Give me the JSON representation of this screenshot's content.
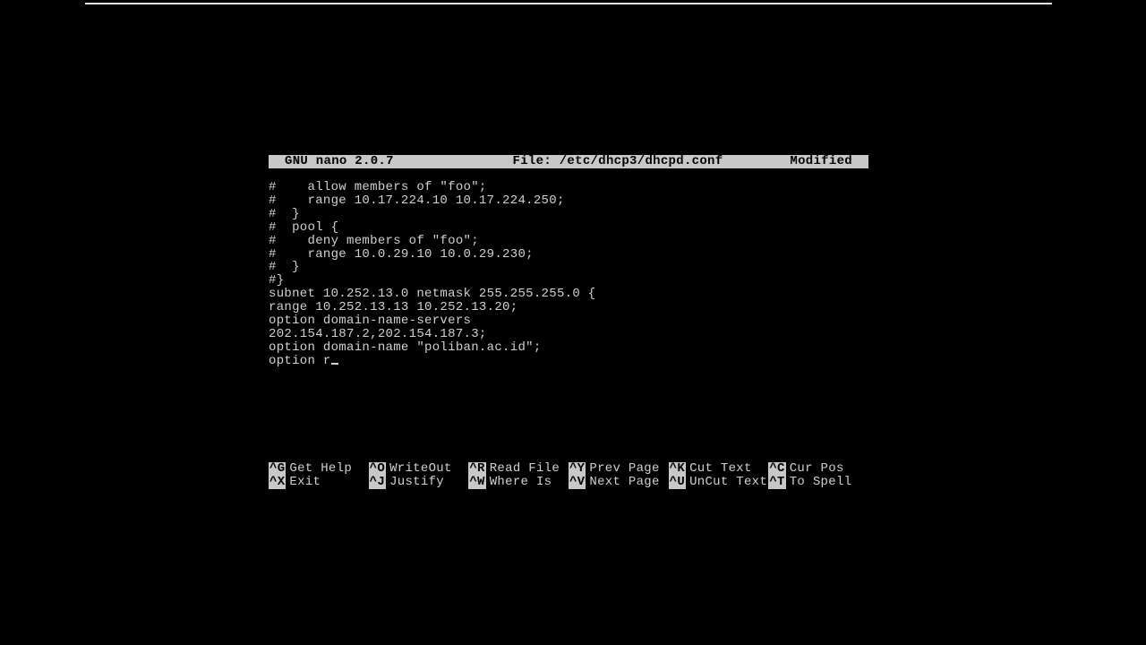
{
  "titlebar": {
    "app": "GNU nano 2.0.7",
    "file_prefix": "File: ",
    "file_path": "/etc/dhcp3/dhcpd.conf",
    "state": "Modified"
  },
  "buffer_lines": [
    "#    allow members of \"foo\";",
    "#    range 10.17.224.10 10.17.224.250;",
    "#  }",
    "#  pool {",
    "#    deny members of \"foo\";",
    "#    range 10.0.29.10 10.0.29.230;",
    "#  }",
    "#}",
    "subnet 10.252.13.0 netmask 255.255.255.0 {",
    "range 10.252.13.13 10.252.13.20;",
    "option domain-name-servers",
    "202.154.187.2,202.154.187.3;",
    "option domain-name \"poliban.ac.id\";",
    "option r"
  ],
  "cursor_line": 13,
  "shortcuts_row1": [
    {
      "key": "^G",
      "label": "Get Help"
    },
    {
      "key": "^O",
      "label": "WriteOut"
    },
    {
      "key": "^R",
      "label": "Read File"
    },
    {
      "key": "^Y",
      "label": "Prev Page"
    },
    {
      "key": "^K",
      "label": "Cut Text"
    },
    {
      "key": "^C",
      "label": "Cur Pos"
    }
  ],
  "shortcuts_row2": [
    {
      "key": "^X",
      "label": "Exit"
    },
    {
      "key": "^J",
      "label": "Justify"
    },
    {
      "key": "^W",
      "label": "Where Is"
    },
    {
      "key": "^V",
      "label": "Next Page"
    },
    {
      "key": "^U",
      "label": "UnCut Text"
    },
    {
      "key": "^T",
      "label": "To Spell"
    }
  ]
}
